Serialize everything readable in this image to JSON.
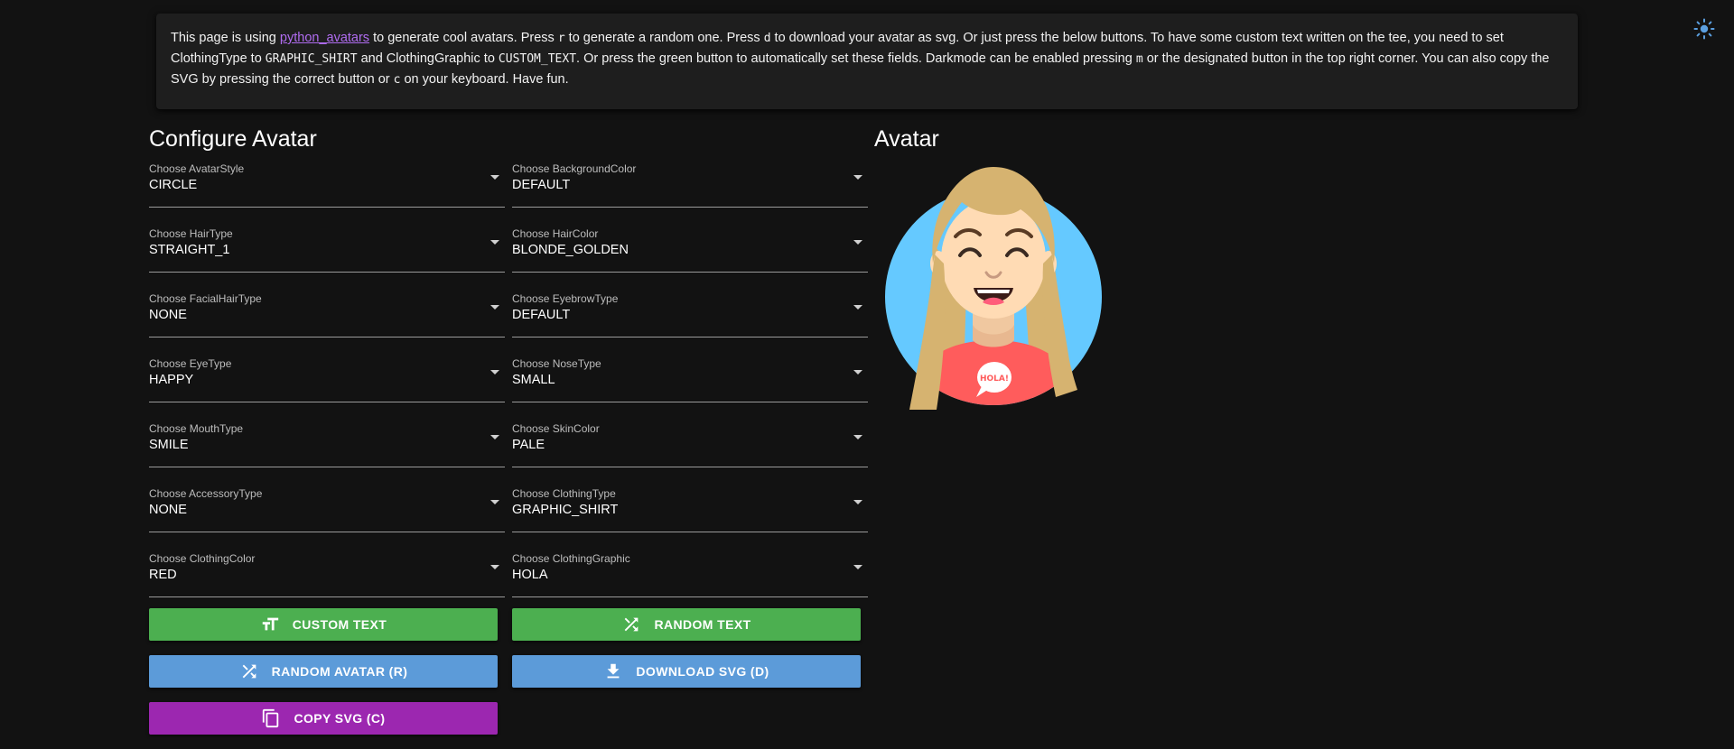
{
  "info": {
    "t1": "This page is using ",
    "link": "python_avatars",
    "t2": " to generate cool avatars. Press ",
    "k1": "r",
    "t3": " to generate a random one. Press ",
    "k2": "d",
    "t4": " to download your avatar as svg. Or just press the below buttons. To have some custom text written on the tee, you need to set ClothingType to ",
    "k3": "GRAPHIC_SHIRT",
    "t5": " and ClothingGraphic to ",
    "k4": "CUSTOM_TEXT",
    "t6": ". Or press the green button to automatically set these fields. Darkmode can be enabled pressing ",
    "k5": "m",
    "t7": " or the designated button in the top right corner. You can also copy the SVG by pressing the correct button or ",
    "k6": "c",
    "t8": " on your keyboard. Have fun."
  },
  "theme_toggle_icon": "sun-icon",
  "config_title": "Configure Avatar",
  "avatar_title": "Avatar",
  "fields": [
    {
      "label": "Choose AvatarStyle",
      "value": "CIRCLE"
    },
    {
      "label": "Choose BackgroundColor",
      "value": "DEFAULT"
    },
    {
      "label": "Choose HairType",
      "value": "STRAIGHT_1"
    },
    {
      "label": "Choose HairColor",
      "value": "BLONDE_GOLDEN"
    },
    {
      "label": "Choose FacialHairType",
      "value": "NONE"
    },
    {
      "label": "Choose EyebrowType",
      "value": "DEFAULT"
    },
    {
      "label": "Choose EyeType",
      "value": "HAPPY"
    },
    {
      "label": "Choose NoseType",
      "value": "SMALL"
    },
    {
      "label": "Choose MouthType",
      "value": "SMILE"
    },
    {
      "label": "Choose SkinColor",
      "value": "PALE"
    },
    {
      "label": "Choose AccessoryType",
      "value": "NONE"
    },
    {
      "label": "Choose ClothingType",
      "value": "GRAPHIC_SHIRT"
    },
    {
      "label": "Choose ClothingColor",
      "value": "RED"
    },
    {
      "label": "Choose ClothingGraphic",
      "value": "HOLA"
    }
  ],
  "buttons": {
    "custom_text": {
      "label": "CUSTOM TEXT",
      "icon": "format-size-icon",
      "color": "#4caf50"
    },
    "random_text": {
      "label": "RANDOM TEXT",
      "icon": "shuffle-icon",
      "color": "#4caf50"
    },
    "random_avatar": {
      "label": "RANDOM AVATAR (R)",
      "icon": "shuffle-icon",
      "color": "#5c9bd9"
    },
    "download_svg": {
      "label": "DOWNLOAD SVG (D)",
      "icon": "download-icon",
      "color": "#5c9bd9"
    },
    "copy_svg": {
      "label": "COPY SVG (C)",
      "icon": "copy-icon",
      "color": "#9c27b0"
    }
  },
  "avatar": {
    "background_color": "#65c9ff",
    "hair_color": "#d6b370",
    "skin_color": "#ffdbb4",
    "shirt_color": "#ff5c5c",
    "graphic_text": "HOLA!"
  }
}
